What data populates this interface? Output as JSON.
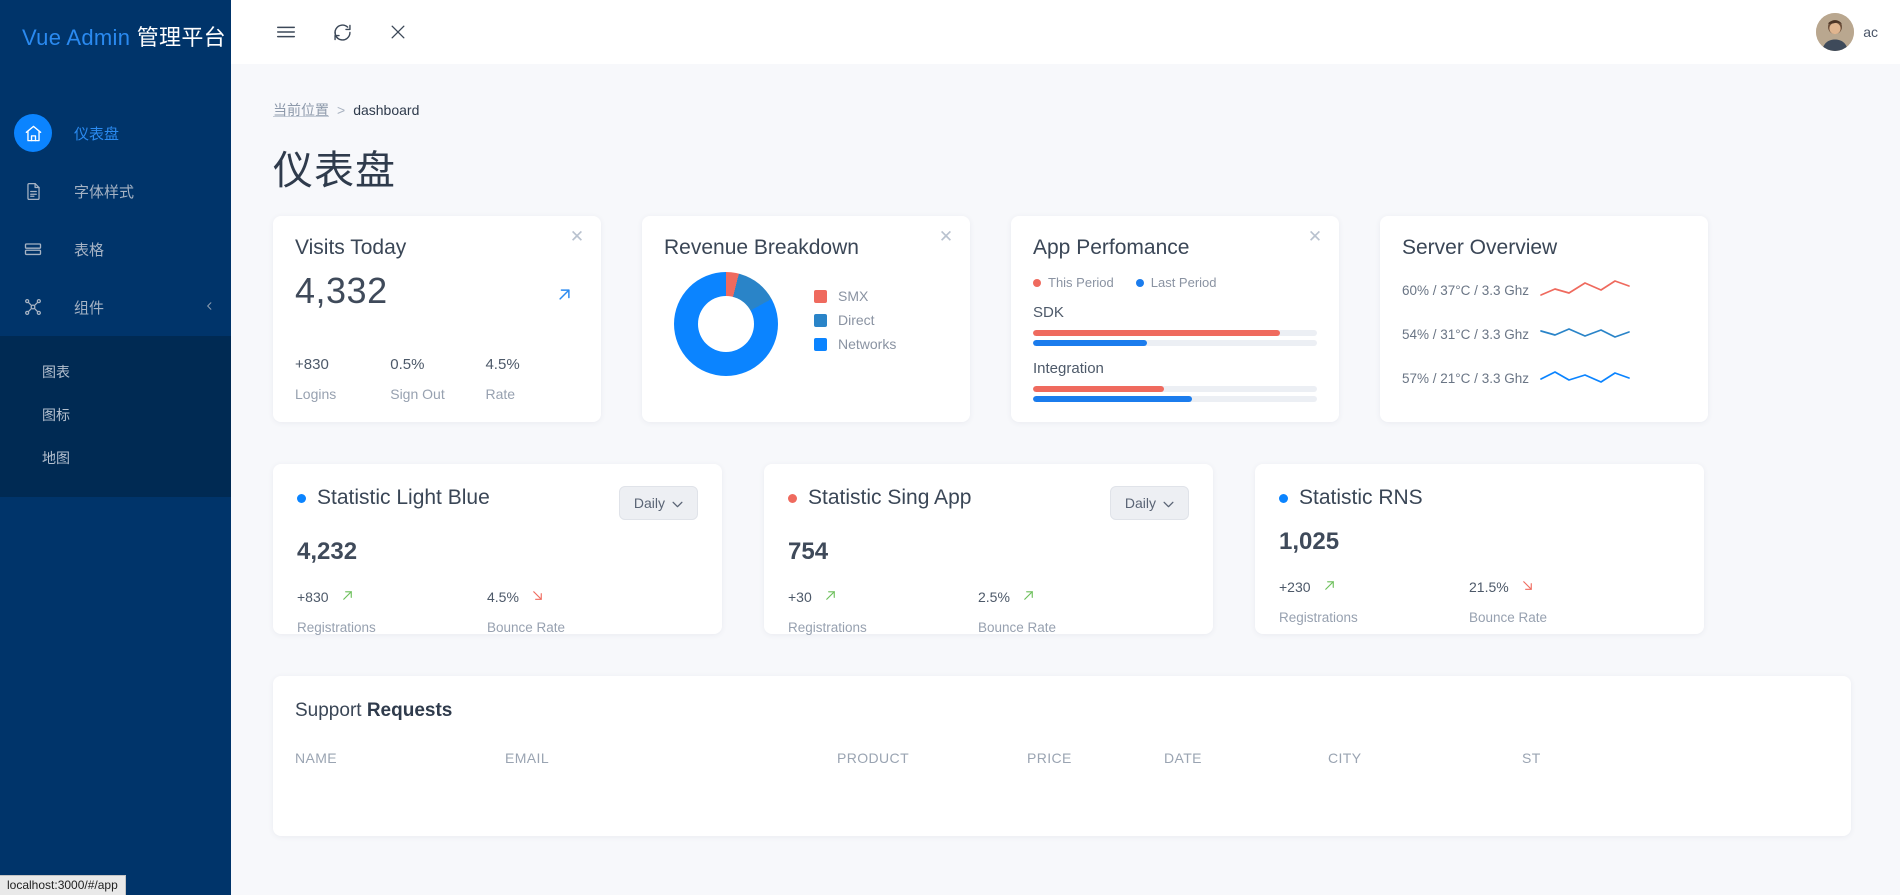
{
  "sidebar": {
    "brand_primary": "Vue Admin",
    "brand_secondary": "管理平台",
    "items": [
      {
        "label": "仪表盘",
        "icon": "home-icon",
        "active": true
      },
      {
        "label": "字体样式",
        "icon": "document-icon",
        "active": false
      },
      {
        "label": "表格",
        "icon": "table-icon",
        "active": false
      },
      {
        "label": "组件",
        "icon": "components-icon",
        "active": false,
        "expanded": true
      }
    ],
    "subitems": [
      {
        "label": "图表"
      },
      {
        "label": "图标"
      },
      {
        "label": "地图"
      }
    ]
  },
  "statusbar": {
    "url": "localhost:3000/#/app"
  },
  "topbar": {
    "menu_icon": "hamburger-icon",
    "refresh_icon": "refresh-icon",
    "close_icon": "close-icon",
    "user_name": "ac"
  },
  "breadcrumb": {
    "current_label": "当前位置",
    "separator": ">",
    "page": "dashboard"
  },
  "page": {
    "title": "仪表盘"
  },
  "colors": {
    "accent_blue": "#0b84ff",
    "mid_blue": "#2a84c8",
    "red": "#ef6a5e",
    "green": "#6cbf5a",
    "sidebar_bg": "#00346a"
  },
  "cards": {
    "visits": {
      "title": "Visits Today",
      "value": "4,332",
      "close_icon": "close-icon",
      "trend_icon": "arrow-up-right-icon",
      "stats": [
        {
          "value": "+830",
          "label": "Logins"
        },
        {
          "value": "0.5%",
          "label": "Sign Out"
        },
        {
          "value": "4.5%",
          "label": "Rate"
        }
      ]
    },
    "revenue": {
      "title": "Revenue Breakdown",
      "close_icon": "close-icon",
      "legend": [
        {
          "label": "SMX",
          "color": "#ef6a5e"
        },
        {
          "label": "Direct",
          "color": "#2a84c8"
        },
        {
          "label": "Networks",
          "color": "#0b84ff"
        }
      ]
    },
    "app_performance": {
      "title": "App Perfomance",
      "close_icon": "close-icon",
      "periods": [
        {
          "label": "This Period",
          "color": "#ef6a5e"
        },
        {
          "label": "Last Period",
          "color": "#1b7ced"
        }
      ],
      "rows": [
        {
          "name": "SDK",
          "this_period": 87,
          "last_period": 40
        },
        {
          "name": "Integration",
          "this_period": 46,
          "last_period": 56
        }
      ]
    },
    "server": {
      "title": "Server Overview",
      "rows": [
        {
          "text": "60% / 37°C / 3.3 Ghz",
          "color": "#ef6a5e"
        },
        {
          "text": "54% / 31°C / 3.3 Ghz",
          "color": "#2a84c8"
        },
        {
          "text": "57% / 21°C / 3.3 Ghz",
          "color": "#0b84ff"
        }
      ]
    }
  },
  "statistics": [
    {
      "title": "Statistic Light Blue",
      "dot_color": "#0b84ff",
      "period": "Daily",
      "value": "4,232",
      "metrics": [
        {
          "value": "+830",
          "label": "Registrations",
          "direction": "up"
        },
        {
          "value": "4.5%",
          "label": "Bounce Rate",
          "direction": "down"
        }
      ]
    },
    {
      "title": "Statistic Sing App",
      "dot_color": "#ef6a5e",
      "period": "Daily",
      "value": "754",
      "metrics": [
        {
          "value": "+30",
          "label": "Registrations",
          "direction": "up"
        },
        {
          "value": "2.5%",
          "label": "Bounce Rate",
          "direction": "up"
        }
      ]
    },
    {
      "title": "Statistic RNS",
      "dot_color": "#0b84ff",
      "period": "Daily",
      "value": "1,025",
      "metrics": [
        {
          "value": "+230",
          "label": "Registrations",
          "direction": "up"
        },
        {
          "value": "21.5%",
          "label": "Bounce Rate",
          "direction": "down"
        }
      ]
    }
  ],
  "support": {
    "title_prefix": "Support ",
    "title_bold": "Requests",
    "columns": [
      "NAME",
      "EMAIL",
      "PRODUCT",
      "PRICE",
      "DATE",
      "CITY",
      "ST"
    ]
  },
  "chart_data": {
    "type": "pie",
    "title": "Revenue Breakdown",
    "labels": [
      "SMX",
      "Direct",
      "Networks"
    ],
    "values": [
      4,
      13,
      83
    ],
    "colors": [
      "#ef6a5e",
      "#2a84c8",
      "#0b84ff"
    ],
    "legend_position": "right",
    "donut": true
  }
}
